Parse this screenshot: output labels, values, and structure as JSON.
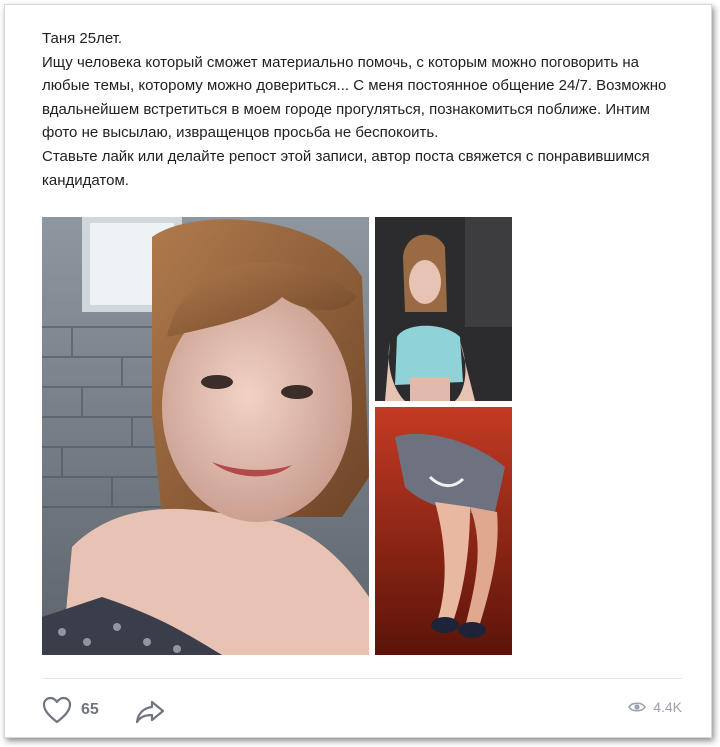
{
  "post": {
    "lines": [
      "Таня 25лет.",
      "Ищу человека который сможет материально помочь, с которым можно поговорить на любые темы, которому можно довериться... С меня постоянное общение 24/7. Возможно вдальнейшем встретиться в моем городе прогуляться, познакомиться поближе. Интим фото не высылаю, извращенцов просьба не беспокоить.",
      "Ставьте лайк или делайте репост этой записи, автор поста свяжется с понравившимся кандидатом."
    ]
  },
  "photos": {
    "main": "portrait-selfie",
    "top": "mirror-selfie",
    "bottom": "legs-selfie"
  },
  "actions": {
    "like_icon": "heart-icon",
    "like_count": "65",
    "share_icon": "share-arrow-icon",
    "views_icon": "eye-icon",
    "views_count": "4.4K"
  },
  "colors": {
    "text": "#1f1f1f",
    "muted": "#6f7680",
    "border": "#d3d9de"
  }
}
